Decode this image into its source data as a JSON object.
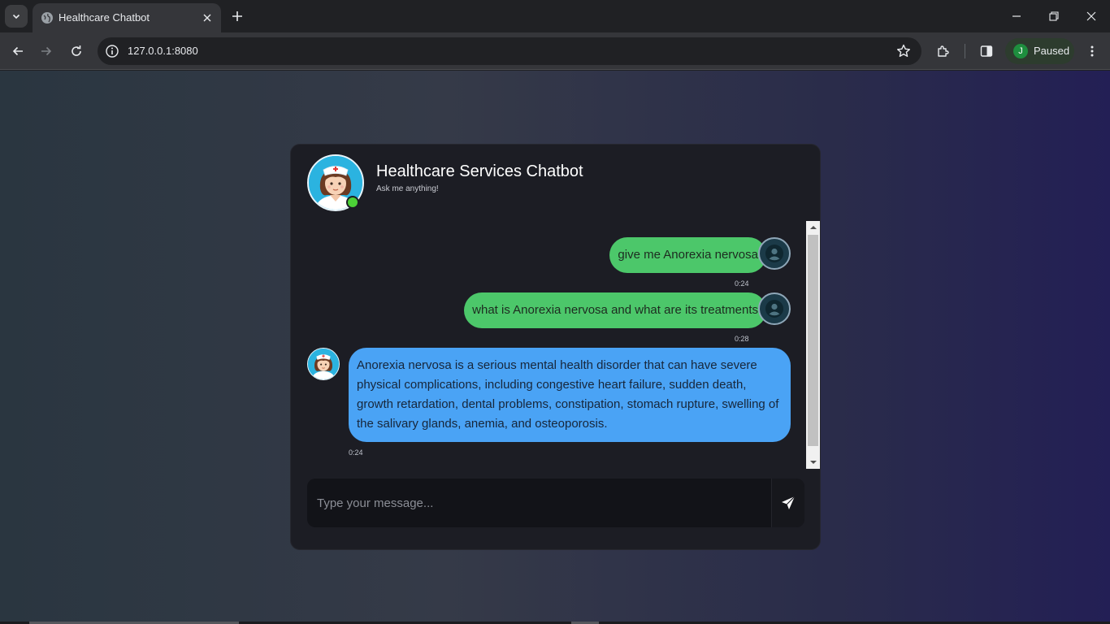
{
  "browser": {
    "tab_title": "Healthcare Chatbot",
    "url": "127.0.0.1:8080",
    "profile_initial": "J",
    "profile_status": "Paused"
  },
  "chat": {
    "title": "Healthcare Services Chatbot",
    "subtitle": "Ask me anything!",
    "messages": [
      {
        "sender": "user",
        "text": "give me Anorexia nervosa",
        "time": "0:24"
      },
      {
        "sender": "user",
        "text": "what is Anorexia nervosa and what are its treatments",
        "time": "0:28"
      },
      {
        "sender": "bot",
        "text": "Anorexia nervosa is a serious mental health disorder that can have severe physical complications, including congestive heart failure, sudden death, growth retardation, dental problems, constipation, stomach rupture, swelling of the salivary glands, anemia, and osteoporosis.",
        "time": "0:24"
      }
    ],
    "input_placeholder": "Type your message..."
  },
  "colors": {
    "user_bubble": "#4cc76a",
    "bot_bubble": "#4aa3f5",
    "online_indicator": "#4cd137",
    "card_background": "#1c1d24"
  },
  "icons": {
    "send": "send-icon",
    "user_avatar": "user-icon",
    "bot_avatar": "nurse-avatar"
  }
}
